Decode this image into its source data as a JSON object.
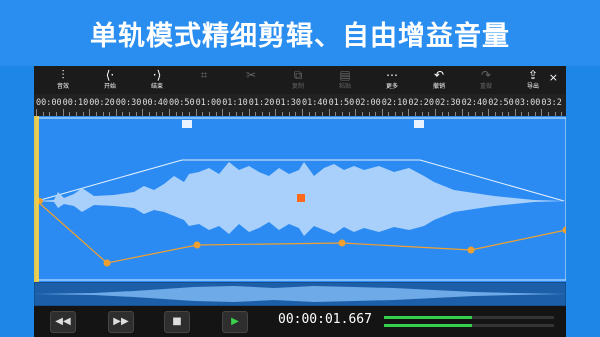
{
  "banner": {
    "title": "单轨模式精细剪辑、自由增益音量"
  },
  "toolbar": {
    "items": [
      {
        "icon": "mixer-icon",
        "glyph": "⫶",
        "label": "音效",
        "disabled": false
      },
      {
        "icon": "start-bracket-icon",
        "glyph": "⟨·",
        "label": "开始",
        "disabled": false
      },
      {
        "icon": "end-bracket-icon",
        "glyph": "·⟩",
        "label": "结束",
        "disabled": false
      },
      {
        "icon": "crop-icon",
        "glyph": "⌗",
        "label": "",
        "disabled": true
      },
      {
        "icon": "cut-icon",
        "glyph": "✂",
        "label": "",
        "disabled": true
      },
      {
        "icon": "copy-icon",
        "glyph": "⧉",
        "label": "复制",
        "disabled": true
      },
      {
        "icon": "paste-icon",
        "glyph": "▤",
        "label": "粘贴",
        "disabled": true
      },
      {
        "icon": "more-icon",
        "glyph": "⋯",
        "label": "更多",
        "disabled": false
      },
      {
        "icon": "undo-icon",
        "glyph": "↶",
        "label": "撤销",
        "disabled": false
      },
      {
        "icon": "redo-icon",
        "glyph": "↷",
        "label": "重做",
        "disabled": true
      },
      {
        "icon": "export-icon",
        "glyph": "⇪",
        "label": "导出",
        "disabled": false
      }
    ],
    "close_glyph": "×"
  },
  "ruler": {
    "labels": [
      "00:00",
      "00:10",
      "00:20",
      "00:30",
      "00:40",
      "00:50",
      "01:00",
      "01:10",
      "01:20",
      "01:30",
      "01:40",
      "01:50",
      "02:00",
      "02:10",
      "02:20",
      "02:30",
      "02:40",
      "02:50",
      "03:00",
      "03:2"
    ]
  },
  "transport": {
    "rewind_glyph": "◀◀",
    "forward_glyph": "▶▶",
    "stop_glyph": "■",
    "play_glyph": "▶",
    "time": "00:00:01.667",
    "level_left": 0.52,
    "level_right": 0.52
  },
  "colors": {
    "play": "#3ad14c",
    "envelope": "#f0a030",
    "marker": "#ff6a1a"
  }
}
